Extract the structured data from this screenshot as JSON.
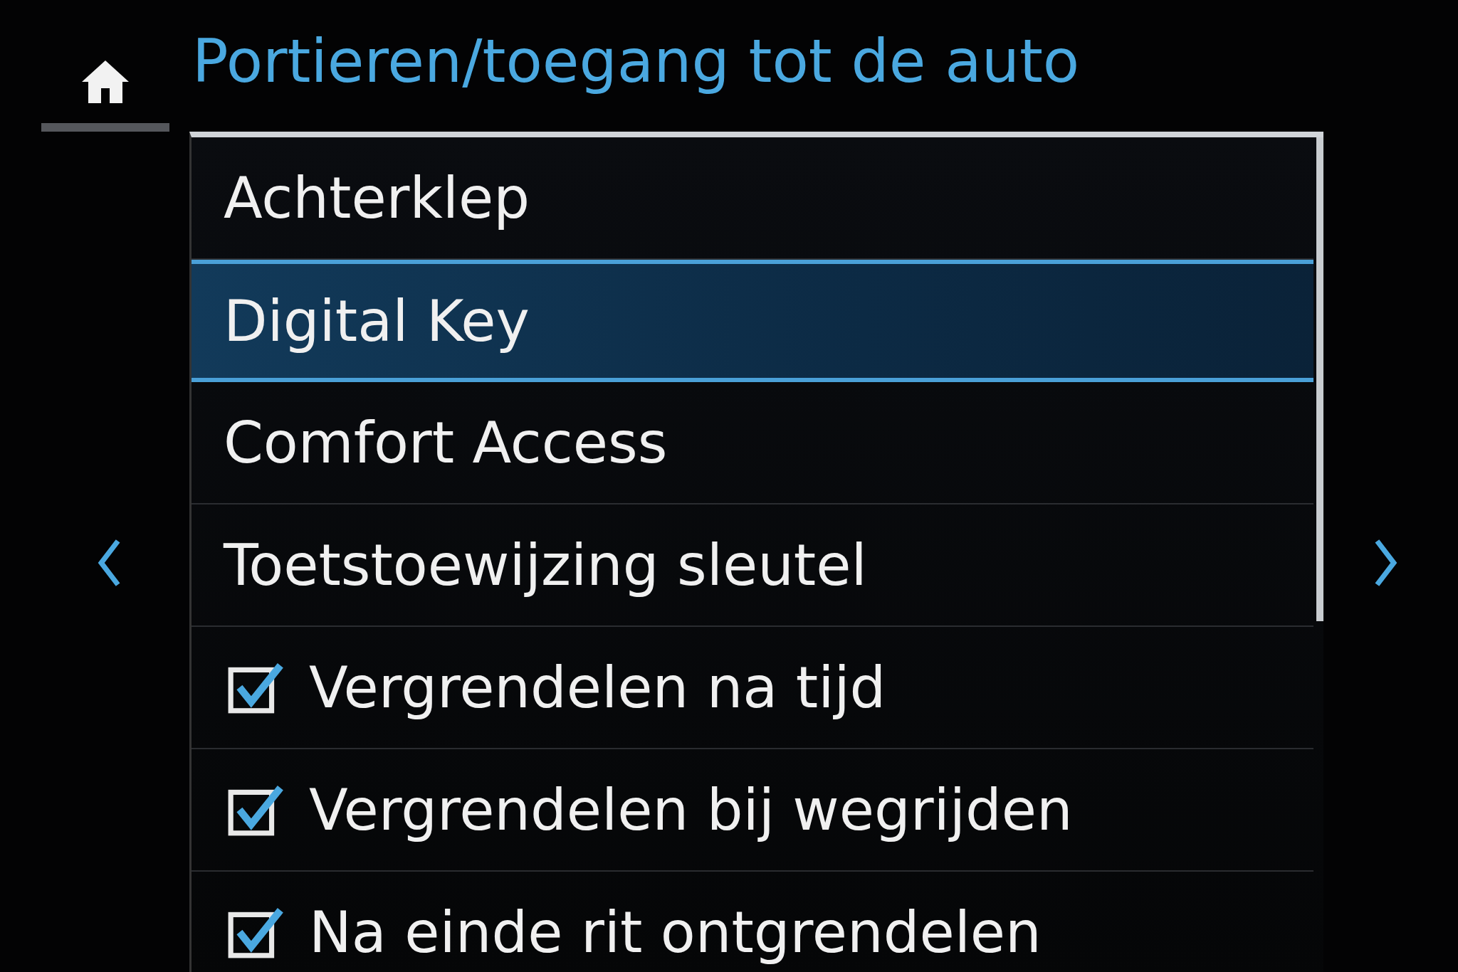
{
  "header": {
    "title": "Portieren/toegang tot de auto"
  },
  "menu": {
    "items": [
      {
        "kind": "item",
        "label": "Achterklep",
        "selected": false
      },
      {
        "kind": "item",
        "label": "Digital Key",
        "selected": true
      },
      {
        "kind": "item",
        "label": "Comfort Access",
        "selected": false
      },
      {
        "kind": "item",
        "label": "Toetstoewijzing sleutel",
        "selected": false
      },
      {
        "kind": "checkbox",
        "label": "Vergrendelen na tijd",
        "selected": false,
        "checked": true
      },
      {
        "kind": "checkbox",
        "label": "Vergrendelen bij wegrijden",
        "selected": false,
        "checked": true
      },
      {
        "kind": "checkbox",
        "label": "Na einde rit ontgrendelen",
        "selected": false,
        "checked": true
      }
    ]
  }
}
